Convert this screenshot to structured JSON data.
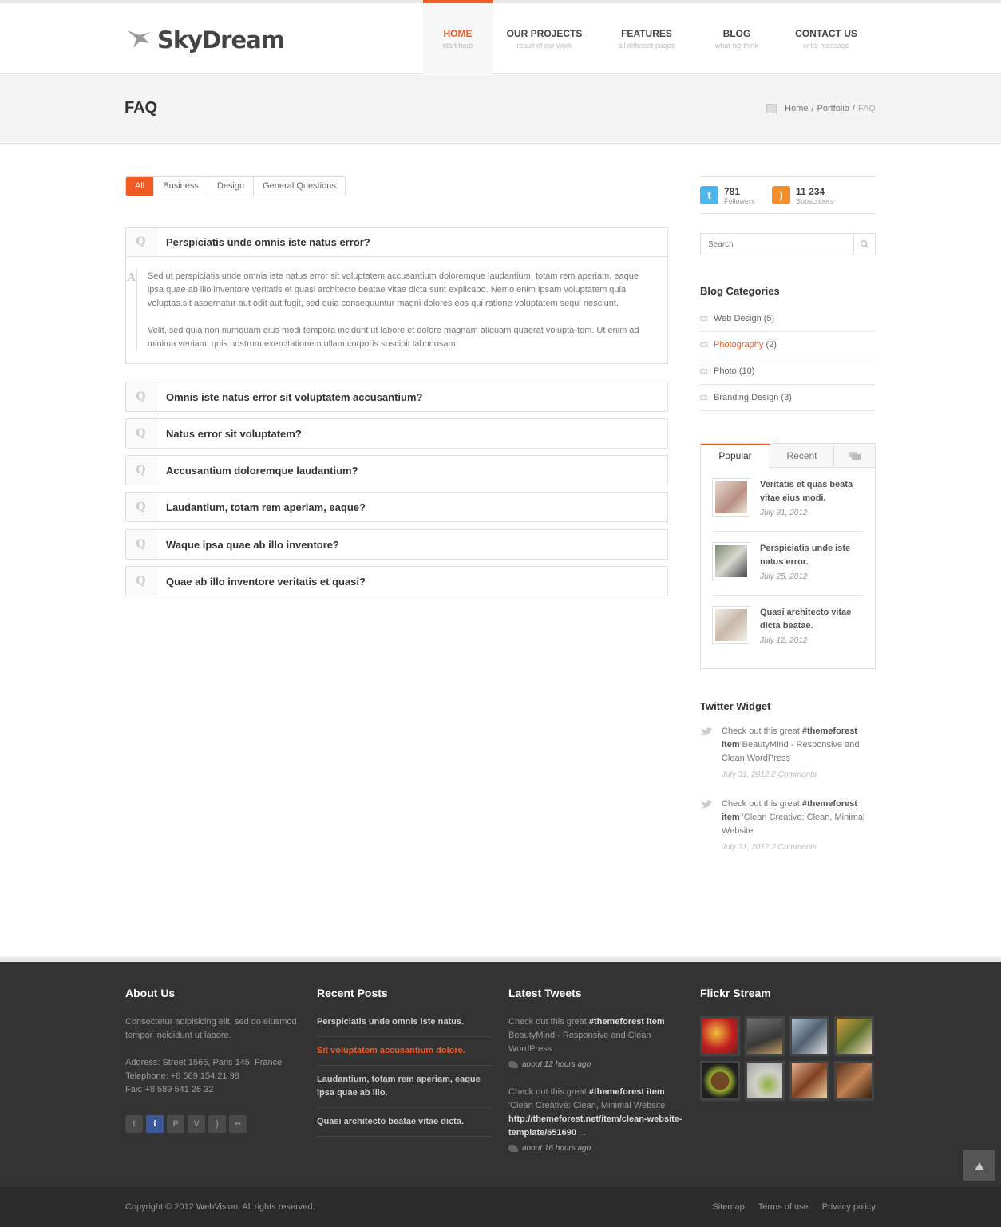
{
  "brand": {
    "name": "SkyDream",
    "accent": "#f15a24"
  },
  "nav": [
    {
      "label": "HOME",
      "sub": "start here",
      "active": true
    },
    {
      "label": "OUR PROJECTS",
      "sub": "result of our work"
    },
    {
      "label": "FEATURES",
      "sub": "all different pages"
    },
    {
      "label": "BLOG",
      "sub": "what we think"
    },
    {
      "label": "CONTACT US",
      "sub": "write message"
    }
  ],
  "title_bar": {
    "title": "FAQ",
    "breadcrumb": [
      "Home",
      "Portfolio",
      "FAQ"
    ],
    "separator": "/"
  },
  "filters": [
    "All",
    "Business",
    "Design",
    "General Questions"
  ],
  "faq": {
    "q_mark": "Q",
    "a_mark": "A",
    "items": [
      {
        "question": "Perspiciatis unde omnis iste natus error?",
        "answer_p1": "Sed ut perspiciatis unde omnis iste natus error sit voluptatem accusantium doloremque laudantium, totam rem aperiam, eaque ipsa quae ab illo inventore veritatis et quasi architecto beatae vitae dicta sunt explicabo. Nemo enim ipsam voluptatem quia voluptas.sit aspernatur aut odit aut fugit, sed quia consequuntur magni dolores eos qui ratione voluptatem sequi nesciunt.",
        "answer_p2": "Velit, sed quia non numquam eius modi tempora incidunt ut labore et dolore magnam aliquam quaerat volupta-tem. Ut enim ad minima veniam, quis nostrum exercitationem ullam corporis suscipit laboriosam."
      },
      {
        "question": "Omnis iste natus error sit voluptatem accusantium?"
      },
      {
        "question": "Natus error sit voluptatem?"
      },
      {
        "question": "Accusantium doloremque laudantium?"
      },
      {
        "question": "Laudantium, totam rem aperiam, eaque?"
      },
      {
        "question": "Waque ipsa quae ab illo inventore?"
      },
      {
        "question": "Quae ab illo inventore veritatis et quasi?"
      }
    ]
  },
  "sidebar": {
    "twitter": {
      "count": "781",
      "caption": "Followers",
      "icon": "twitter-icon"
    },
    "rss": {
      "count": "11 234",
      "caption": "Subscribers",
      "icon": "rss-icon"
    },
    "search": {
      "placeholder": "Search",
      "icon": "search-icon"
    },
    "categories": {
      "title": "Blog Categories",
      "items": [
        {
          "name": "Web Design",
          "count": "(5)"
        },
        {
          "name": "Photography",
          "count": "(2)",
          "highlight": true
        },
        {
          "name": "Photo",
          "count": "(10)"
        },
        {
          "name": "Branding Design",
          "count": "(3)"
        }
      ]
    },
    "tabs": {
      "labels": [
        "Popular",
        "Recent"
      ],
      "comments_icon": "comments-icon",
      "posts": [
        {
          "title": "Veritatis et quas beata vitae eius modi.",
          "date": "July 31, 2012"
        },
        {
          "title": "Perspiciatis unde iste natus error.",
          "date": "July 25, 2012"
        },
        {
          "title": "Quasi architecto vitae dicta beatae.",
          "date": "July 12, 2012"
        }
      ]
    },
    "twitter_widget": {
      "title": "Twitter Widget",
      "tweets": [
        {
          "pre": "Check out this great ",
          "tag": "#themeforest item",
          "post": " BeautyMind - Responsive and Clean WordPress",
          "meta": "July 31, 2012 2 Comments"
        },
        {
          "pre": "Check out this great ",
          "tag": "#themeforest item",
          "post": " 'Clean Creative: Clean, Minimal Website",
          "meta": "July 31, 2012 2 Comments"
        }
      ]
    }
  },
  "footer": {
    "about": {
      "title": "About Us",
      "text": "Consectetur adipisicing elit, sed do eiusmod tempor incididunt ut labore.",
      "address": "Address: Street 1565, Paris 145, France",
      "phone": "Telephone: +8 589 154 21 98",
      "fax": "Fax: +8 589 541 26 32",
      "social": [
        "twitter-icon",
        "facebook-icon",
        "pinterest-icon",
        "vimeo-icon",
        "rss-icon",
        "flickr-icon"
      ]
    },
    "recent_posts": {
      "title": "Recent Posts",
      "items": [
        {
          "text": "Perspiciatis unde omnis iste natus."
        },
        {
          "text": "Sit voluptatem accusantium dolore.",
          "highlight": true
        },
        {
          "text": "Laudantium, totam rem aperiam, eaque ipsa quae ab illo."
        },
        {
          "text": "Quasi architecto beatae vitae dicta."
        }
      ]
    },
    "latest_tweets": {
      "title": "Latest Tweets",
      "items": [
        {
          "pre": "Check out this great ",
          "tag": "#themeforest item",
          "post": " BeautyMind - Responsive and Clean WordPress",
          "link": "",
          "time": "about 12 hours ago"
        },
        {
          "pre": "Check out this great ",
          "tag": "#themeforest item",
          "post": " 'Clean Creative: Clean, Minimal Website ",
          "link": "http://themeforest.net/item/clean-website-template/651690",
          "tail": " ...",
          "time": "about 16 hours ago"
        }
      ]
    },
    "flickr": {
      "title": "Flickr Stream"
    },
    "copyright": "Copyright © 2012 WebVision. All rights reserved.",
    "links": [
      "Sitemap",
      "Terms of use",
      "Privacy policy"
    ],
    "to_top_icon": "arrow-up-icon"
  }
}
